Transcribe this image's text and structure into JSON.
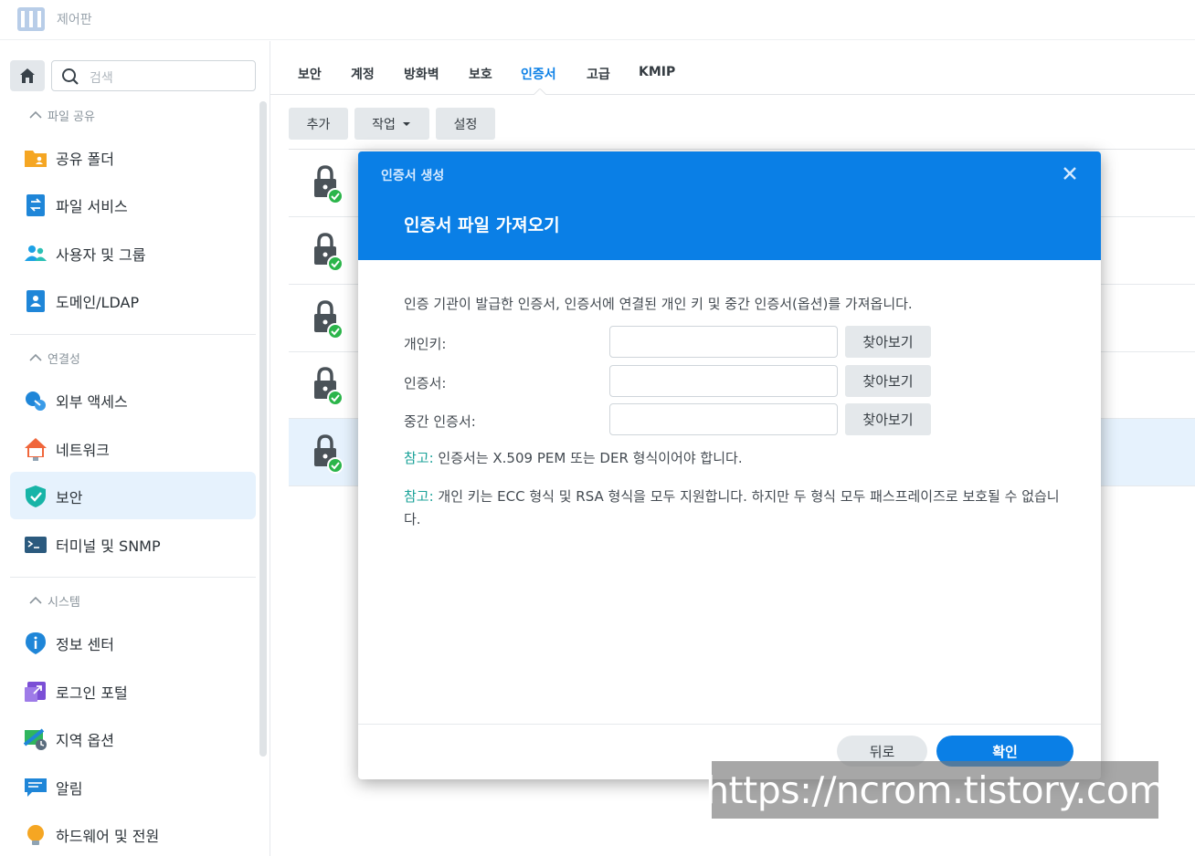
{
  "window": {
    "title": "제어판"
  },
  "sidebar": {
    "search_placeholder": "검색",
    "sections": [
      {
        "title": "파일 공유",
        "items": [
          {
            "label": "공유 폴더",
            "icon": "shared-folder-icon"
          },
          {
            "label": "파일 서비스",
            "icon": "file-services-icon"
          },
          {
            "label": "사용자 및 그룹",
            "icon": "users-groups-icon"
          },
          {
            "label": "도메인/LDAP",
            "icon": "domain-ldap-icon"
          }
        ]
      },
      {
        "title": "연결성",
        "items": [
          {
            "label": "외부 액세스",
            "icon": "external-access-icon"
          },
          {
            "label": "네트워크",
            "icon": "network-icon"
          },
          {
            "label": "보안",
            "icon": "security-shield-icon",
            "active": true
          },
          {
            "label": "터미널 및 SNMP",
            "icon": "terminal-icon"
          }
        ]
      },
      {
        "title": "시스템",
        "items": [
          {
            "label": "정보 센터",
            "icon": "info-center-icon"
          },
          {
            "label": "로그인 포털",
            "icon": "login-portal-icon"
          },
          {
            "label": "지역 옵션",
            "icon": "regional-options-icon"
          },
          {
            "label": "알림",
            "icon": "notification-icon"
          },
          {
            "label": "하드웨어 및 전원",
            "icon": "hardware-power-icon"
          }
        ]
      }
    ]
  },
  "tabs": [
    {
      "label": "보안"
    },
    {
      "label": "계정"
    },
    {
      "label": "방화벽"
    },
    {
      "label": "보호"
    },
    {
      "label": "인증서",
      "active": true
    },
    {
      "label": "고급"
    },
    {
      "label": "KMIP"
    }
  ],
  "toolbar": {
    "add": "추가",
    "action": "작업",
    "settings": "설정"
  },
  "dialog": {
    "title": "인증서 생성",
    "subtitle": "인증서 파일 가져오기",
    "description": "인증 기관이 발급한 인증서, 인증서에 연결된 개인 키 및 중간 인증서(옵션)를 가져옵니다.",
    "fields": [
      {
        "label": "개인키:",
        "value": "",
        "browse": "찾아보기"
      },
      {
        "label": "인증서:",
        "value": "",
        "browse": "찾아보기"
      },
      {
        "label": "중간 인증서:",
        "value": "",
        "browse": "찾아보기"
      }
    ],
    "notes": [
      {
        "label": "참고:",
        "text": " 인증서는 X.509 PEM 또는 DER 형식이어야 합니다."
      },
      {
        "label": "참고:",
        "text": " 개인 키는 ECC 형식 및 RSA 형식을 모두 지원합니다. 하지만 두 형식 모두 패스프레이즈로 보호될 수 없습니다."
      }
    ],
    "back": "뒤로",
    "ok": "확인"
  },
  "watermark": "https://ncrom.tistory.com",
  "colors": {
    "accent": "#0a7fe6",
    "note": "#1da39a",
    "selected_row": "#e6f2fd"
  }
}
